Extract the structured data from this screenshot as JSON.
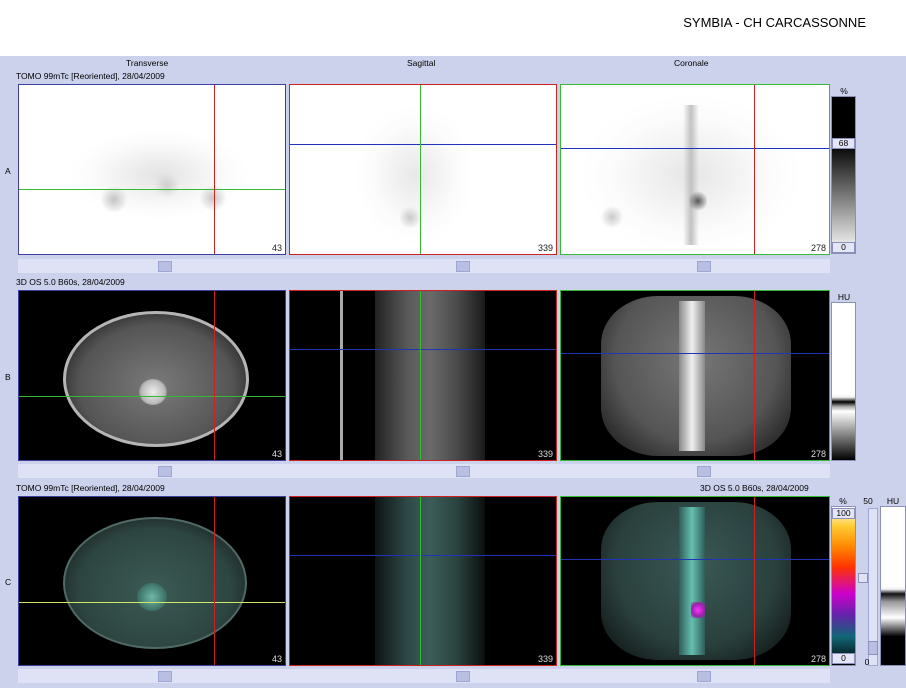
{
  "header": {
    "title": "SYMBIA - CH CARCASSONNE"
  },
  "columns": {
    "transverse": "Transverse",
    "sagittal": "Sagittal",
    "coronal": "Coronale"
  },
  "rows": {
    "a": {
      "label": "A",
      "series": "TOMO 99mTc [Reoriented], 28/04/2009"
    },
    "b": {
      "label": "B",
      "series": "3D  OS  5.0  B60s, 28/04/2009"
    },
    "c": {
      "label": "C",
      "series_left": "TOMO 99mTc [Reoriented], 28/04/2009",
      "series_right": "3D  OS  5.0  B60s, 28/04/2009"
    }
  },
  "slices": {
    "transverse": "43",
    "sagittal": "339",
    "coronal": "278"
  },
  "colorbars": {
    "a": {
      "unit": "%",
      "level": "68",
      "min": "0"
    },
    "b": {
      "unit": "HU"
    },
    "c": {
      "unit_pct": "%",
      "max": "100",
      "min": "0",
      "mid": "50",
      "unit_hu": "HU",
      "hu_min": "0"
    }
  },
  "colors": {
    "accent_red": "#cc2222",
    "accent_green": "#33bb33",
    "accent_blue": "#2233bb"
  }
}
